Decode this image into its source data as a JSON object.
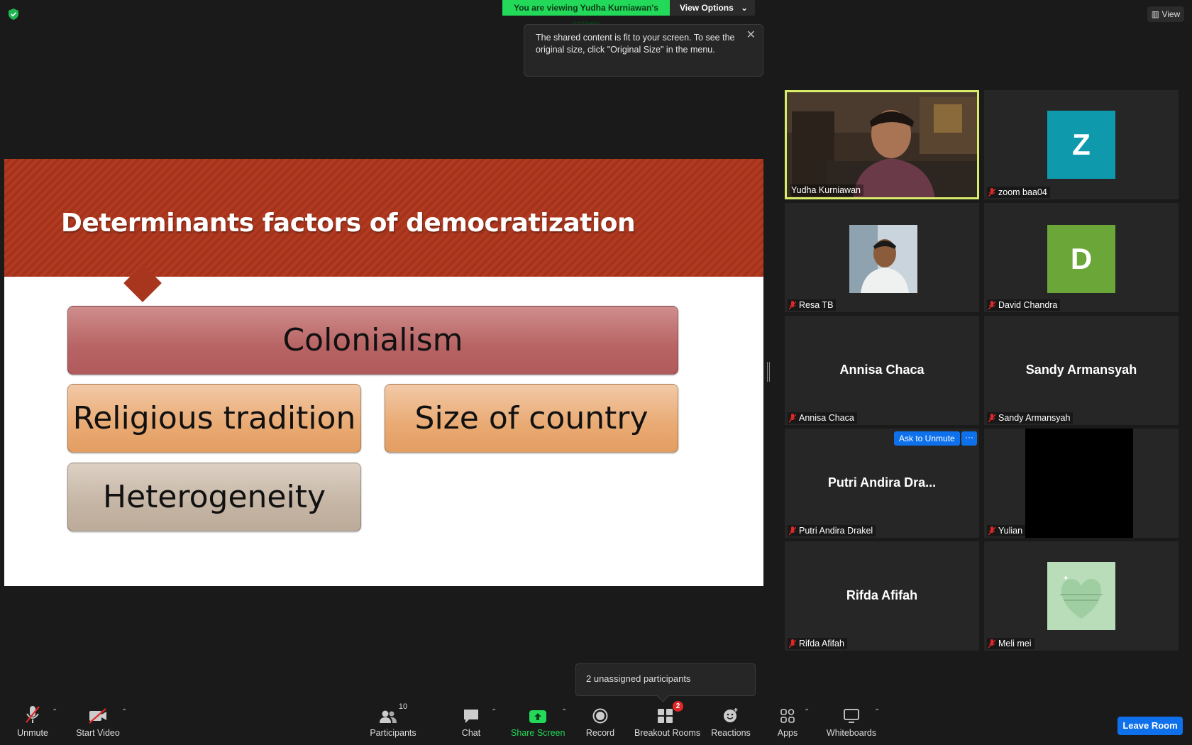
{
  "top": {
    "viewing_text": "You are viewing Yudha Kurniawan's screen",
    "view_options_label": "View Options",
    "view_label": "View",
    "tip_text": "The shared content is fit to your screen. To see the original size, click \"Original Size\" in the menu."
  },
  "slide": {
    "title": "Determinants factors of democratization",
    "boxes": [
      "Colonialism",
      "Religious tradition",
      "Size of country",
      "Heterogeneity"
    ]
  },
  "participants": [
    {
      "name": "Yudha Kurniawan"
    },
    {
      "name": "zoom baa04",
      "avatar": "Z",
      "avatar_color": "#0e9aac"
    },
    {
      "name": "Resa TB"
    },
    {
      "name": "David Chandra",
      "avatar": "D",
      "avatar_color": "#6aa638"
    },
    {
      "name": "Annisa Chaca",
      "display": "Annisa Chaca"
    },
    {
      "name": "Sandy Armansyah",
      "display": "Sandy Armansyah"
    },
    {
      "name": "Putri Andira Drakel",
      "display": "Putri Andira Dra..."
    },
    {
      "name": "Yulian"
    },
    {
      "name": "Rifda Afifah",
      "display": "Rifda Afifah"
    },
    {
      "name": "Meli mei"
    }
  ],
  "ask_to_unmute_label": "Ask to Unmute",
  "more_label": "···",
  "unassigned_text": "2 unassigned participants",
  "toolbar": {
    "unmute": "Unmute",
    "start_video": "Start Video",
    "participants": "Participants",
    "participants_count": "10",
    "chat": "Chat",
    "share_screen": "Share Screen",
    "record": "Record",
    "breakout_rooms": "Breakout Rooms",
    "breakout_badge": "2",
    "reactions": "Reactions",
    "apps": "Apps",
    "whiteboards": "Whiteboards",
    "leave_room": "Leave Room"
  },
  "colors": {
    "share_green": "#23d959",
    "accent_blue": "#0e71eb",
    "active_speaker": "#d9ec6a",
    "slide_header": "#b23a21"
  }
}
